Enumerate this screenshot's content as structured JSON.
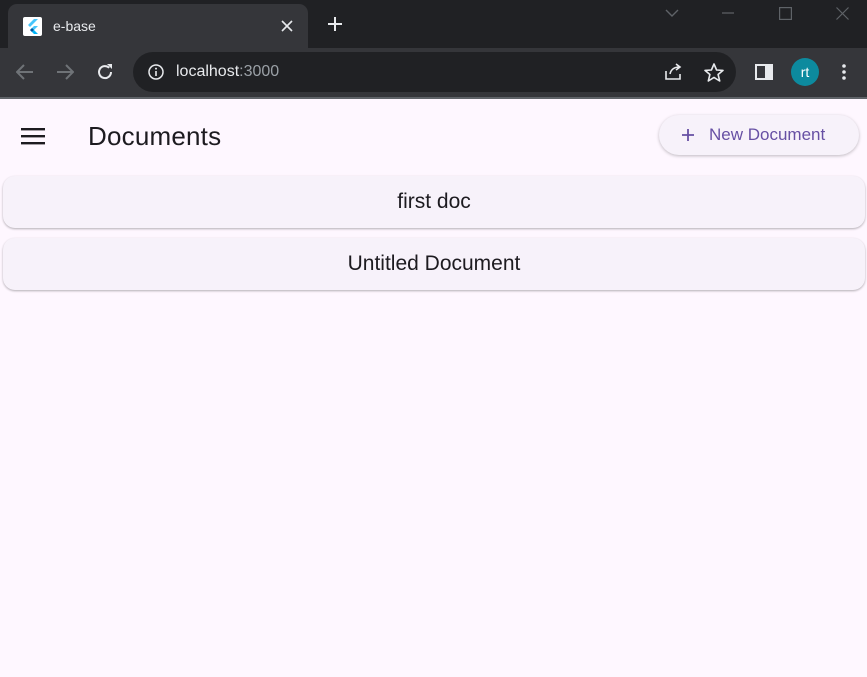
{
  "browser": {
    "tab": {
      "title": "e-base",
      "favicon": "flutter-icon"
    },
    "address": {
      "host": "localhost",
      "port": ":3000"
    },
    "profile": {
      "initials": "rt",
      "color": "#0d8a9e"
    },
    "icons": {
      "back": "back-arrow-icon",
      "forward": "forward-arrow-icon",
      "reload": "reload-icon",
      "info": "info-icon",
      "share": "share-icon",
      "bookmark": "star-icon",
      "side_panel": "side-panel-icon",
      "menu": "kebab-menu-icon"
    }
  },
  "app": {
    "title": "Documents",
    "new_document_label": "New Document",
    "accent_color": "#6750a4",
    "documents": [
      {
        "title": "first doc"
      },
      {
        "title": "Untitled Document"
      }
    ]
  }
}
